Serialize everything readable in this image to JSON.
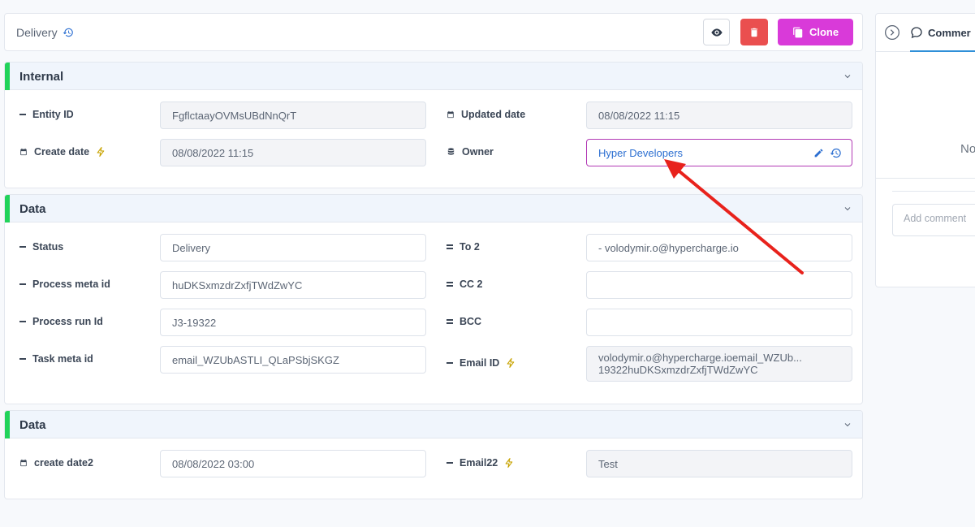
{
  "header": {
    "title": "Delivery",
    "clone_label": "Clone"
  },
  "sections": [
    {
      "title": "Internal",
      "fields": [
        {
          "label": "Entity ID",
          "value": "FgflctaayOVMsUBdNnQrT"
        },
        {
          "label": "Create date",
          "value": "08/08/2022 11:15"
        },
        {
          "label": "Updated date",
          "value": "08/08/2022 11:15"
        },
        {
          "label": "Owner",
          "value": "Hyper Developers"
        }
      ]
    },
    {
      "title": "Data",
      "fields": [
        {
          "label": "Status",
          "value": "Delivery"
        },
        {
          "label": "Process meta id",
          "value": "huDKSxmzdrZxfjTWdZwYC"
        },
        {
          "label": "Process run Id",
          "value": "J3-19322"
        },
        {
          "label": "Task meta id",
          "value": "email_WZUbASTLI_QLaPSbjSKGZ"
        },
        {
          "label": "To 2",
          "value": "- volodymir.o@hypercharge.io"
        },
        {
          "label": "CC 2",
          "value": ""
        },
        {
          "label": "BCC",
          "value": ""
        },
        {
          "label": "Email ID",
          "value": "volodymir.o@hypercharge.ioemail_WZUb... 19322huDKSxmzdrZxfjTWdZwYC"
        }
      ]
    },
    {
      "title": "Data",
      "fields": [
        {
          "label": "create date2",
          "value": "08/08/2022 03:00"
        },
        {
          "label": "Email22",
          "value": "Test"
        }
      ]
    }
  ],
  "right_panel": {
    "tab_label": "Commer",
    "empty_text": "No",
    "comment_placeholder": "Add comment"
  },
  "colors": {
    "accent_green": "#22d35a",
    "delete_red": "#ea4f4f",
    "clone_magenta": "#d93ad9",
    "owner_border": "#b23ab5",
    "link_blue": "#2c6fd1",
    "annotation_arrow": "#e8221c"
  },
  "icons": [
    "history-icon",
    "eye-icon",
    "trash-icon",
    "copy-icon",
    "chevron-down-icon",
    "calendar-icon",
    "lightning-icon",
    "database-icon",
    "pencil-icon",
    "chevron-right-circle-icon",
    "chat-icon"
  ]
}
